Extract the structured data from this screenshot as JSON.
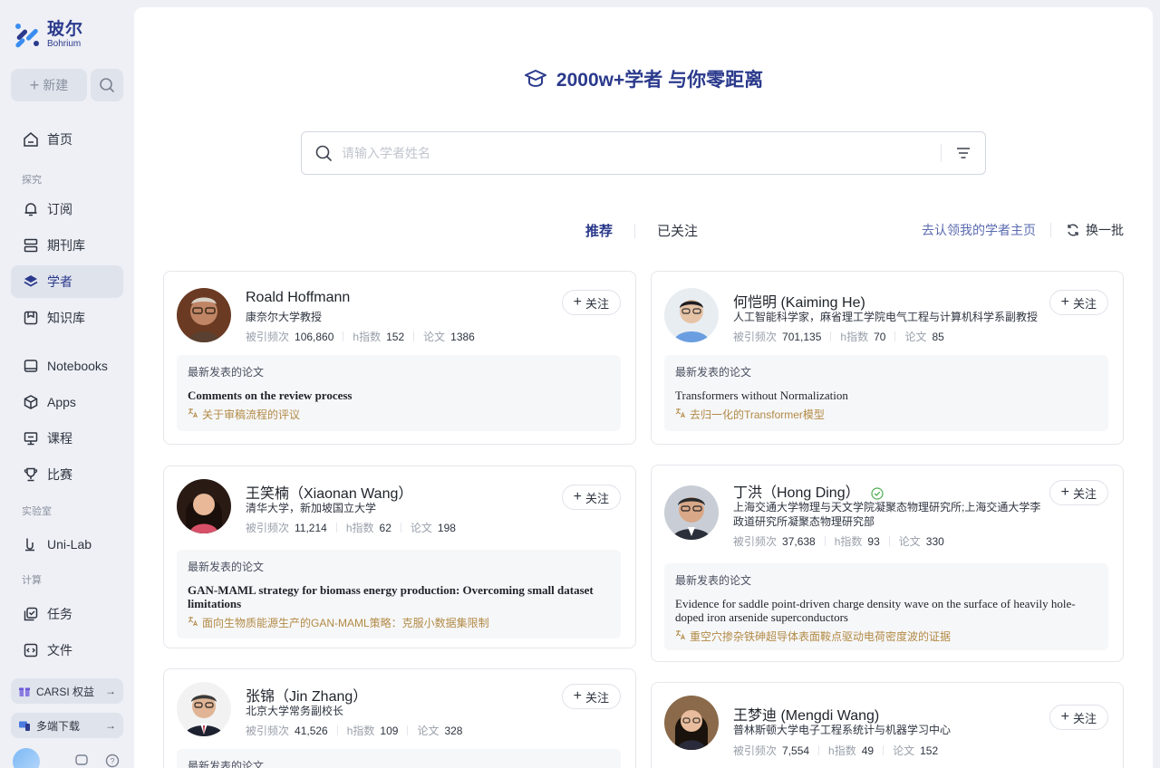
{
  "brand": {
    "name_cn": "玻尔",
    "name_en": "Bohrium"
  },
  "sidebar": {
    "new_label": "新建",
    "items": [
      {
        "label": "首页"
      },
      {
        "section": "探究"
      },
      {
        "label": "订阅"
      },
      {
        "label": "期刊库"
      },
      {
        "label": "学者"
      },
      {
        "label": "知识库"
      },
      {
        "label": "Notebooks"
      },
      {
        "label": "Apps"
      },
      {
        "label": "课程"
      },
      {
        "label": "比赛"
      },
      {
        "section": "实验室"
      },
      {
        "label": "Uni-Lab"
      },
      {
        "section": "计算"
      },
      {
        "label": "任务"
      },
      {
        "label": "文件"
      }
    ],
    "promo1": "CARSI 权益",
    "promo2": "多端下载"
  },
  "hero": {
    "title": "2000w+学者 与你零距离"
  },
  "search": {
    "placeholder": "请输入学者姓名"
  },
  "tabs": {
    "recommend": "推荐",
    "followed": "已关注"
  },
  "links": {
    "claim": "去认领我的学者主页",
    "refresh": "换一批"
  },
  "labels": {
    "citations": "被引频次",
    "hindex": "h指数",
    "papers": "论文",
    "follow": "关注",
    "recent": "最新发表的论文"
  },
  "accent": "#2b3a8c",
  "scholars": [
    {
      "name": "Roald Hoffmann",
      "affil": "康奈尔大学教授",
      "citations": "106,860",
      "hindex": "152",
      "papers": "1386",
      "paper_en": "Comments on the review process",
      "paper_cn": "关于审稿流程的评议"
    },
    {
      "name": "何恺明 (Kaiming He)",
      "affil": "人工智能科学家，麻省理工学院电气工程与计算机科学系副教授",
      "citations": "701,135",
      "hindex": "70",
      "papers": "85",
      "paper_en": "Transformers without Normalization",
      "paper_cn": "去归一化的Transformer模型"
    },
    {
      "name": "王笑楠（Xiaonan Wang）",
      "affil": "清华大学，新加坡国立大学",
      "citations": "11,214",
      "hindex": "62",
      "papers": "198",
      "paper_en": "GAN-MAML strategy for biomass energy production: Overcoming small dataset limitations",
      "paper_cn": "面向生物质能源生产的GAN-MAML策略：克服小数据集限制"
    },
    {
      "name": "丁洪（Hong Ding）",
      "affil": "上海交通大学物理与天文学院凝聚态物理研究所;上海交通大学李政道研究所凝聚态物理研究部",
      "citations": "37,638",
      "hindex": "93",
      "papers": "330",
      "paper_en": "Evidence for saddle point-driven charge density wave on the surface of heavily hole-doped iron arsenide superconductors",
      "paper_cn": "重空穴掺杂铁砷超导体表面鞍点驱动电荷密度波的证据"
    },
    {
      "name": "张锦（Jin Zhang）",
      "affil": "北京大学常务副校长",
      "citations": "41,526",
      "hindex": "109",
      "papers": "328",
      "paper_en": "",
      "paper_cn": ""
    },
    {
      "name": "王梦迪 (Mengdi Wang)",
      "affil": "普林斯顿大学电子工程系统计与机器学习中心",
      "citations": "7,554",
      "hindex": "49",
      "papers": "152",
      "paper_en": "",
      "paper_cn": ""
    }
  ]
}
